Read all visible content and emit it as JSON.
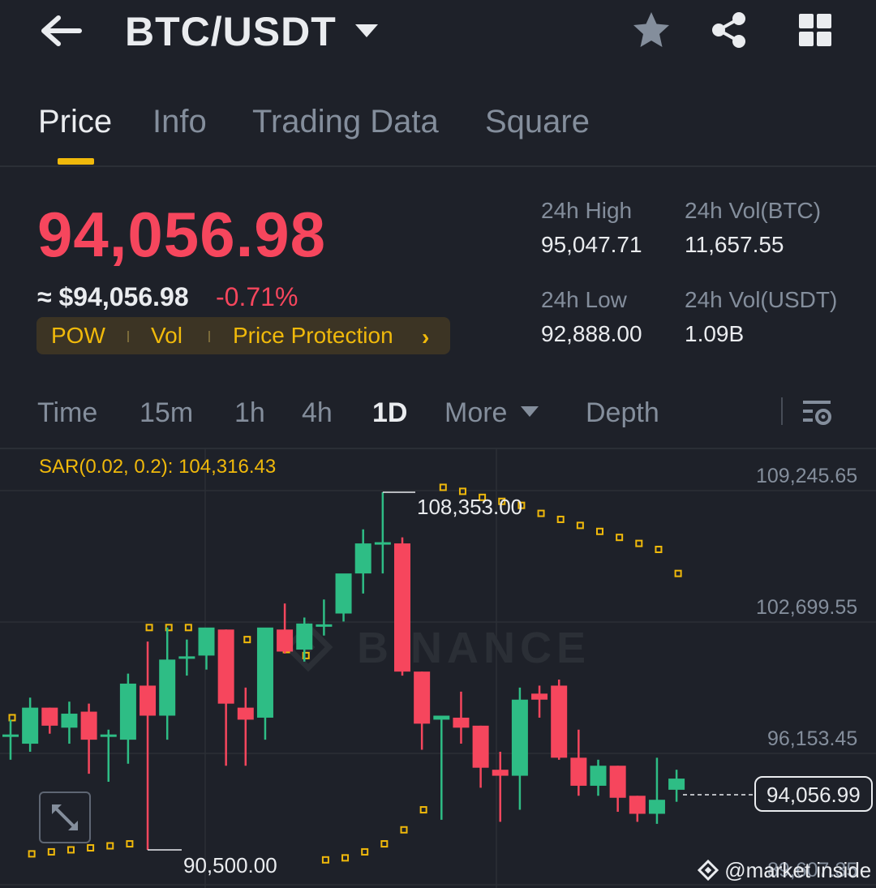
{
  "header": {
    "pair": "BTC/USDT",
    "icons": [
      "back-arrow-icon",
      "caret-down-icon",
      "star-icon",
      "share-icon",
      "grid-icon"
    ]
  },
  "tabs": [
    {
      "label": "Price",
      "active": true
    },
    {
      "label": "Info",
      "active": false
    },
    {
      "label": "Trading Data",
      "active": false
    },
    {
      "label": "Square",
      "active": false
    }
  ],
  "price": {
    "last": "94,056.98",
    "usd": "≈ $94,056.98",
    "change": "-0.71%",
    "tags": [
      "POW",
      "Vol",
      "Price Protection"
    ]
  },
  "stats": {
    "high_label": "24h High",
    "high_value": "95,047.71",
    "low_label": "24h Low",
    "low_value": "92,888.00",
    "vol_btc_label": "24h Vol(BTC)",
    "vol_btc_value": "11,657.55",
    "vol_usdt_label": "24h Vol(USDT)",
    "vol_usdt_value": "1.09B"
  },
  "intervals": [
    {
      "label": "Time",
      "active": false
    },
    {
      "label": "15m",
      "active": false
    },
    {
      "label": "1h",
      "active": false
    },
    {
      "label": "4h",
      "active": false
    },
    {
      "label": "1D",
      "active": true
    },
    {
      "label": "More",
      "active": false
    },
    {
      "label": "Depth",
      "active": false
    }
  ],
  "chart": {
    "sar_label": "SAR(0.02, 0.2): 104,316.43",
    "y_axis": [
      "109,245.65",
      "102,699.55",
      "96,153.45"
    ],
    "y_axis_bottom": "89,607.35",
    "high_marker": "108,353.00",
    "low_marker": "90,500.00",
    "last_price_tag": "94,056.99",
    "watermark_logo": "BINANCE",
    "colors": {
      "up": "#2ebd85",
      "down": "#f6465d",
      "sar": "#f0b90b",
      "accent": "#f0b90b"
    }
  },
  "chart_data": {
    "type": "candlestick",
    "ylim": [
      89607.35,
      109245.65
    ],
    "candles": [
      {
        "o": 96200,
        "h": 97000,
        "l": 95000,
        "c": 96200
      },
      {
        "o": 95800,
        "h": 98100,
        "l": 95400,
        "c": 97600
      },
      {
        "o": 97600,
        "h": 97600,
        "l": 96300,
        "c": 96700
      },
      {
        "o": 96600,
        "h": 97900,
        "l": 95800,
        "c": 97300
      },
      {
        "o": 97400,
        "h": 97800,
        "l": 94300,
        "c": 96000
      },
      {
        "o": 96200,
        "h": 96500,
        "l": 93900,
        "c": 96200
      },
      {
        "o": 96000,
        "h": 99300,
        "l": 94800,
        "c": 98800
      },
      {
        "o": 98700,
        "h": 100900,
        "l": 90500,
        "c": 97200
      },
      {
        "o": 97200,
        "h": 101600,
        "l": 96000,
        "c": 100000
      },
      {
        "o": 100000,
        "h": 101000,
        "l": 99200,
        "c": 100100
      },
      {
        "o": 100200,
        "h": 101500,
        "l": 99500,
        "c": 101600
      },
      {
        "o": 101500,
        "h": 101500,
        "l": 94700,
        "c": 97800
      },
      {
        "o": 97600,
        "h": 98600,
        "l": 94700,
        "c": 97000
      },
      {
        "o": 97100,
        "h": 101300,
        "l": 96000,
        "c": 101600
      },
      {
        "o": 101500,
        "h": 102800,
        "l": 100300,
        "c": 100400
      },
      {
        "o": 100500,
        "h": 102100,
        "l": 99900,
        "c": 101800
      },
      {
        "o": 101700,
        "h": 103000,
        "l": 101200,
        "c": 101700
      },
      {
        "o": 102300,
        "h": 104000,
        "l": 101900,
        "c": 104300
      },
      {
        "o": 104300,
        "h": 106500,
        "l": 103300,
        "c": 105800
      },
      {
        "o": 105800,
        "h": 108353,
        "l": 104300,
        "c": 105800
      },
      {
        "o": 105800,
        "h": 106100,
        "l": 99200,
        "c": 99400
      },
      {
        "o": 99400,
        "h": 99400,
        "l": 95500,
        "c": 96800
      },
      {
        "o": 97000,
        "h": 97000,
        "l": 92000,
        "c": 97200
      },
      {
        "o": 97100,
        "h": 98400,
        "l": 95800,
        "c": 96600
      },
      {
        "o": 96700,
        "h": 96700,
        "l": 93600,
        "c": 94600
      },
      {
        "o": 94500,
        "h": 95400,
        "l": 91900,
        "c": 94200
      },
      {
        "o": 94200,
        "h": 98600,
        "l": 92500,
        "c": 98000
      },
      {
        "o": 98300,
        "h": 98700,
        "l": 97100,
        "c": 98000
      },
      {
        "o": 98700,
        "h": 99000,
        "l": 95000,
        "c": 95100
      },
      {
        "o": 95100,
        "h": 96500,
        "l": 93200,
        "c": 93700
      },
      {
        "o": 93700,
        "h": 95000,
        "l": 93200,
        "c": 94700
      },
      {
        "o": 94700,
        "h": 94700,
        "l": 92400,
        "c": 93100
      },
      {
        "o": 93200,
        "h": 93200,
        "l": 91900,
        "c": 92300
      },
      {
        "o": 92300,
        "h": 95100,
        "l": 91800,
        "c": 93000
      },
      {
        "o": 93500,
        "h": 94500,
        "l": 92900,
        "c": 94057
      }
    ],
    "sar": [
      {
        "i": 0,
        "v": 97100
      },
      {
        "i": 1,
        "v": 90300
      },
      {
        "i": 2,
        "v": 90400
      },
      {
        "i": 3,
        "v": 90500
      },
      {
        "i": 4,
        "v": 90600
      },
      {
        "i": 5,
        "v": 90700
      },
      {
        "i": 6,
        "v": 90800
      },
      {
        "i": 7,
        "v": 101600
      },
      {
        "i": 8,
        "v": 101600
      },
      {
        "i": 9,
        "v": 101600
      },
      {
        "i": 10,
        "v": 101400
      },
      {
        "i": 11,
        "v": 101200
      },
      {
        "i": 12,
        "v": 101000
      },
      {
        "i": 13,
        "v": 100800
      },
      {
        "i": 14,
        "v": 100500
      },
      {
        "i": 15,
        "v": 100200
      },
      {
        "i": 16,
        "v": 90000
      },
      {
        "i": 17,
        "v": 90100
      },
      {
        "i": 18,
        "v": 90400
      },
      {
        "i": 19,
        "v": 90800
      },
      {
        "i": 20,
        "v": 91500
      },
      {
        "i": 21,
        "v": 92500
      },
      {
        "i": 22,
        "v": 108600
      },
      {
        "i": 23,
        "v": 108400
      },
      {
        "i": 24,
        "v": 108100
      },
      {
        "i": 25,
        "v": 107900
      },
      {
        "i": 26,
        "v": 107700
      },
      {
        "i": 27,
        "v": 107300
      },
      {
        "i": 28,
        "v": 107000
      },
      {
        "i": 29,
        "v": 106700
      },
      {
        "i": 30,
        "v": 106400
      },
      {
        "i": 31,
        "v": 106100
      },
      {
        "i": 32,
        "v": 105800
      },
      {
        "i": 33,
        "v": 105500
      },
      {
        "i": 34,
        "v": 104300
      }
    ]
  }
}
